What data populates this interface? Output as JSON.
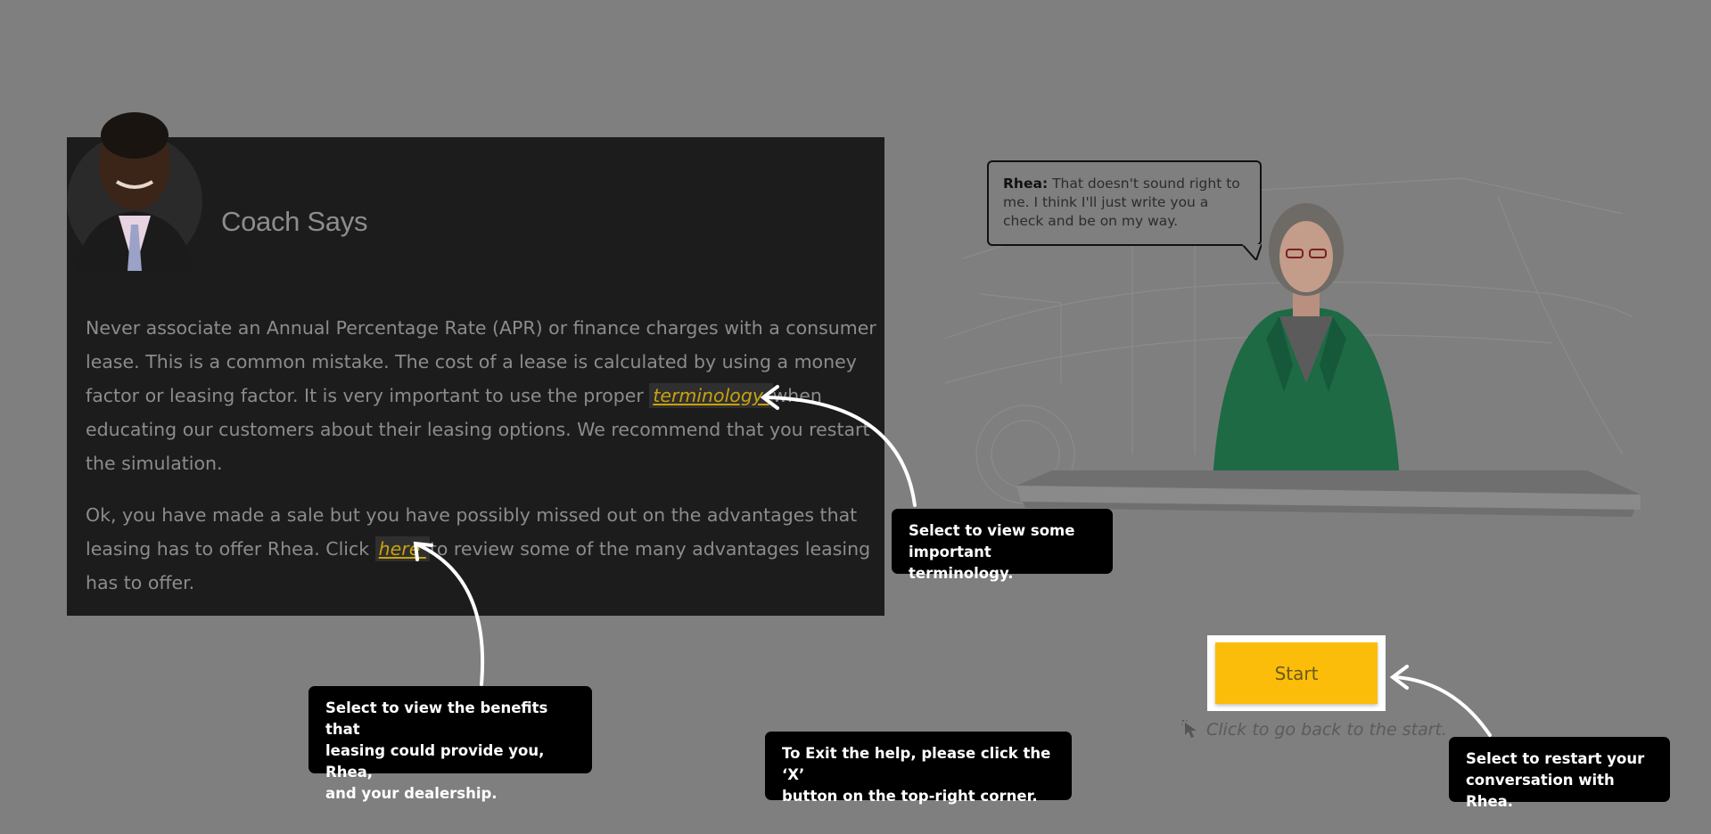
{
  "coach": {
    "title": "Coach Says",
    "para1_before": "Never associate an Annual Percentage Rate (APR) or finance charges with a consumer lease. This is a common mistake. The cost of a lease is calculated by using a money factor or leasing factor. It is very important to use the proper ",
    "para1_link": "terminology ",
    "para1_after": " when educating our customers about their leasing options. We recommend that you restart the simulation.",
    "para2_before": "Ok, you have made a sale but you have possibly missed out on the advantages that leasing has to offer Rhea. Click ",
    "para2_link": "here ",
    "para2_after": " to review some of the many advantages leasing has to offer."
  },
  "bubble": {
    "speaker": "Rhea:",
    "text": " That doesn't sound right to me. I think I'll just write you a check and be on my way."
  },
  "start": {
    "button_label": "Start",
    "hint": "Click to go back to the start."
  },
  "callouts": {
    "terminology": "Select to view some\nimportant terminology.",
    "benefits": "Select to view the benefits that\nleasing could provide you, Rhea,\nand your dealership.",
    "exit": "To Exit the help, please click the ‘X’\nbutton on the top-right corner.",
    "restart": "Select to restart your\nconversation with Rhea."
  },
  "colors": {
    "overlay": "#7f7f7f",
    "panel": "#1c1c1c",
    "link": "#c9a20c",
    "start_button": "#fbbd0a",
    "jacket": "#1d6a45"
  }
}
